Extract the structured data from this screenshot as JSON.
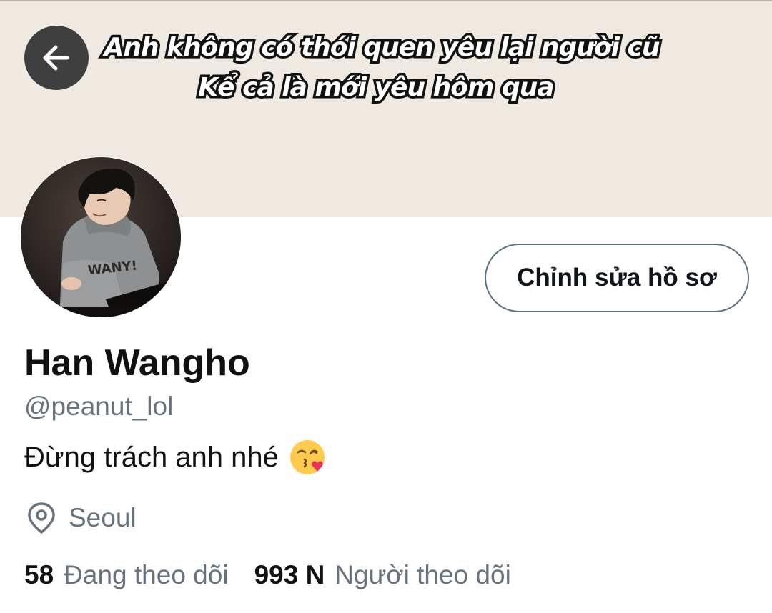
{
  "banner": {
    "line1": "Anh không có thói quen yêu lại người cũ",
    "line2": "Kể cả là mới yêu hôm qua",
    "background_color": "#f0e9e1"
  },
  "header": {
    "back_icon": "arrow-left-icon"
  },
  "profile": {
    "edit_button_label": "Chỉnh sửa hồ sơ",
    "display_name": "Han Wangho",
    "handle": "@peanut_lol",
    "bio_text": "Đừng trách anh nhé",
    "bio_emoji": "face-blowing-a-kiss-emoji",
    "location_icon": "location-pin-icon",
    "location": "Seoul"
  },
  "stats": {
    "following_count": "58",
    "following_label": "Đang theo dõi",
    "followers_count": "993 N",
    "followers_label": "Người theo dõi"
  },
  "colors": {
    "text_primary": "#111111",
    "text_secondary": "#66737f",
    "button_border": "#5d7280",
    "back_button_bg": "#3f3f3f"
  }
}
